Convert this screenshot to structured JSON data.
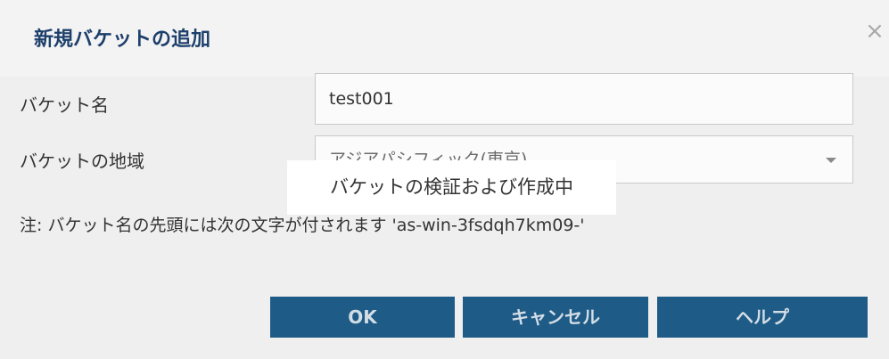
{
  "dialog": {
    "title": "新規バケットの追加",
    "close_glyph": "×"
  },
  "form": {
    "bucket_name_label": "バケット名",
    "bucket_name_value": "test001",
    "region_label": "バケットの地域",
    "region_value": "アジアパシフィック(東京)",
    "note": "注: バケット名の先頭には次の文字が付されます 'as-win-3fsdqh7km09-'"
  },
  "buttons": {
    "ok": "OK",
    "cancel": "キャンセル",
    "help": "ヘルプ"
  },
  "overlay": {
    "progress_message": "バケットの検証および作成中"
  },
  "colors": {
    "title_text": "#1d3f6b",
    "button_bg": "#1e5b86",
    "button_text": "#d3dde6",
    "body_bg": "#efefef",
    "titlebar_bg": "#f3f3f3"
  },
  "icons": {
    "close": "close-icon",
    "dropdown": "chevron-down-icon"
  }
}
